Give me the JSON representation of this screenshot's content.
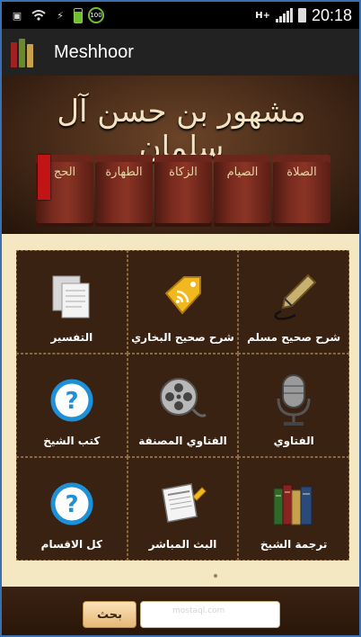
{
  "status_bar": {
    "time": "20:18",
    "network_label": "H+",
    "battery_percent": "100"
  },
  "app": {
    "title": "Meshhoor"
  },
  "banner": {
    "title": "مشهور بن حسن آل سلمان",
    "books": [
      "الحج",
      "الطهارة",
      "الزكاة",
      "الصيام",
      "الصلاة"
    ]
  },
  "grid": {
    "items": [
      {
        "label": "التفسير",
        "icon": "document-icon"
      },
      {
        "label": "شرح صحيح البخاري",
        "icon": "tag-rss-icon"
      },
      {
        "label": "شرح صحيح مسلم",
        "icon": "fountain-pen-icon"
      },
      {
        "label": "كتب الشيخ",
        "icon": "help-icon"
      },
      {
        "label": "الفتاوي المصنفة",
        "icon": "film-reel-icon"
      },
      {
        "label": "الفتاوي",
        "icon": "microphone-icon"
      },
      {
        "label": "كل الاقسام",
        "icon": "help-icon"
      },
      {
        "label": "البث المباشر",
        "icon": "newspaper-icon"
      },
      {
        "label": "ترجمة الشيخ",
        "icon": "books-icon"
      }
    ]
  },
  "search": {
    "button_label": "بحث",
    "input_value": ""
  },
  "watermark": "mostaql.com"
}
